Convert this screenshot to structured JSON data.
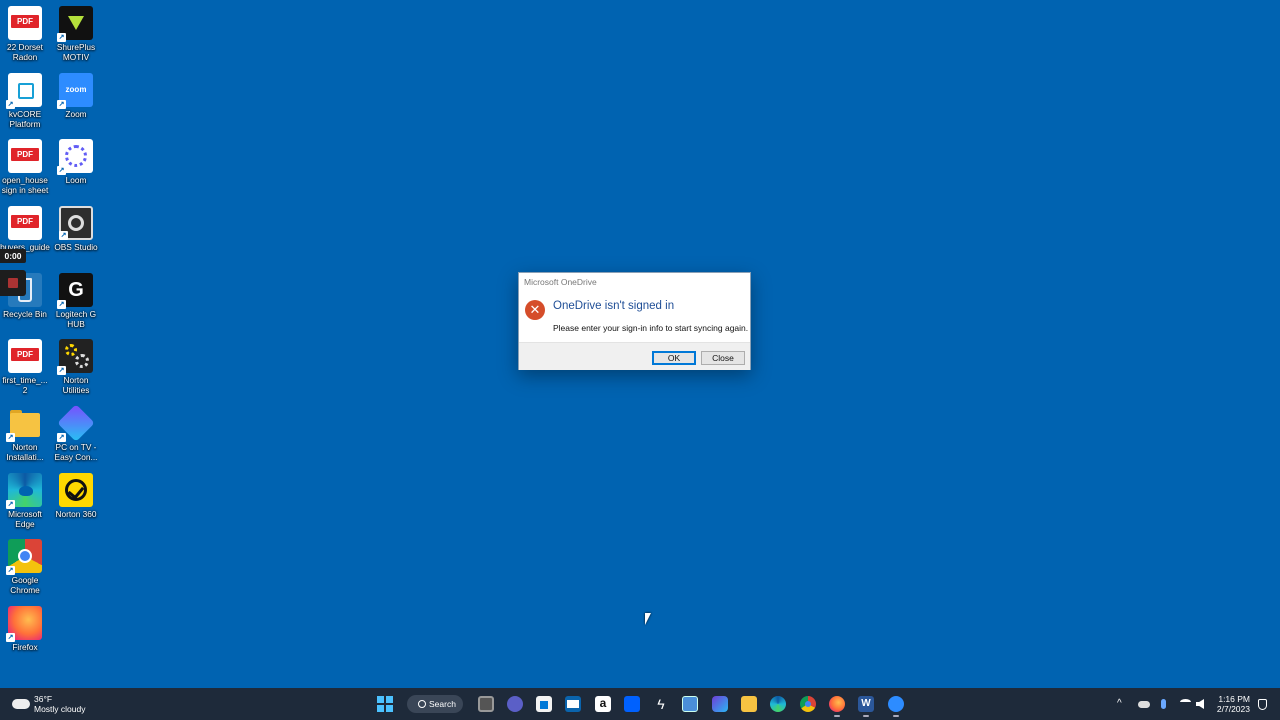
{
  "desktop_icons": [
    {
      "label": "22 Dorset Radon",
      "icon": "pdf-file-icon"
    },
    {
      "label": "ShurePlus MOTIV",
      "icon": "shureplus-icon"
    },
    {
      "label": "kvCORE Platform",
      "icon": "kvcore-icon"
    },
    {
      "label": "Zoom",
      "icon": "zoom-icon"
    },
    {
      "label": "open_house sign in sheet",
      "icon": "pdf-file-icon"
    },
    {
      "label": "Loom",
      "icon": "loom-icon"
    },
    {
      "label": "buyers_guide",
      "icon": "pdf-file-icon"
    },
    {
      "label": "OBS Studio",
      "icon": "obs-icon"
    },
    {
      "label": "Recycle Bin",
      "icon": "recycle-bin-icon"
    },
    {
      "label": "Logitech G HUB",
      "icon": "logitech-ghub-icon"
    },
    {
      "label": "first_time_... 2",
      "icon": "pdf-file-icon"
    },
    {
      "label": "Norton Utilities",
      "icon": "norton-utilities-icon"
    },
    {
      "label": "Norton Installati...",
      "icon": "folder-icon"
    },
    {
      "label": "PC on TV - Easy Con...",
      "icon": "pc-on-tv-icon"
    },
    {
      "label": "Microsoft Edge",
      "icon": "edge-icon"
    },
    {
      "label": "Norton 360",
      "icon": "norton-360-icon"
    },
    {
      "label": "Google Chrome",
      "icon": "chrome-icon"
    },
    {
      "label": "Firefox",
      "icon": "firefox-icon"
    }
  ],
  "pdf_tag": "PDF",
  "zoom_wordmark": "zoom",
  "recording": {
    "timer": "0:00"
  },
  "dialog": {
    "title": "Microsoft OneDrive",
    "heading": "OneDrive isn't signed in",
    "message": "Please enter your sign-in info to start syncing again.",
    "ok_label": "OK",
    "close_label": "Close",
    "error_symbol": "✕"
  },
  "taskbar": {
    "weather_temp": "36°F",
    "weather_desc": "Mostly cloudy",
    "search_label": "Search",
    "word_letter": "W",
    "amazon_letter": "a",
    "apps": [
      "task-view-icon",
      "teams-chat-icon",
      "microsoft-store-icon",
      "mail-icon",
      "amazon-icon",
      "dropbox-icon",
      "lightning-app-icon",
      "photos-icon",
      "video-app-icon",
      "file-explorer-icon",
      "edge-icon",
      "chrome-icon",
      "firefox-icon",
      "word-icon",
      "zoom-icon"
    ]
  },
  "clock": {
    "time": "1:16 PM",
    "date": "2/7/2023"
  },
  "colors": {
    "desktop": "#0063b1",
    "taskbar": "#1e2a3a",
    "error": "#d54d2a",
    "accent": "#0078d7"
  }
}
